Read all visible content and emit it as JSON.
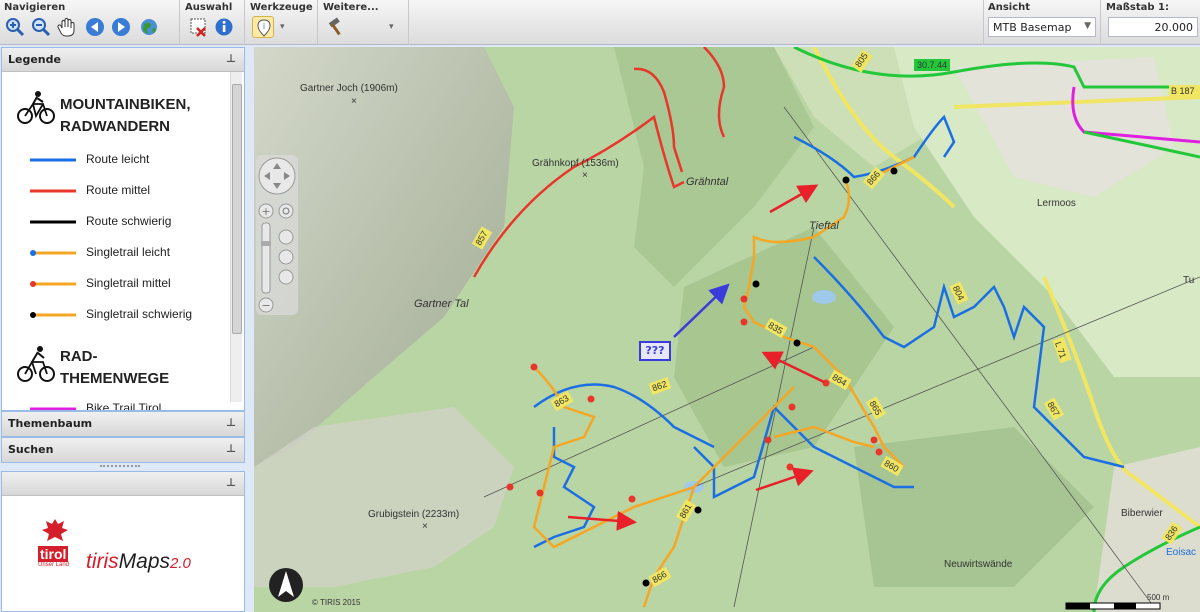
{
  "toolbar": {
    "navigate_label": "Navigieren",
    "select_label": "Auswahl",
    "tools_label": "Werkzeuge",
    "more_label": "Weitere...",
    "view_label": "Ansicht",
    "view_value": "MTB Basemap",
    "scale_label": "Maßstab 1:",
    "scale_value": "20.000",
    "icons": [
      "zoom-in-icon",
      "zoom-out-icon",
      "pan-hand-icon",
      "back-arrow-icon",
      "forward-arrow-icon",
      "globe-icon",
      "clear-selection-icon",
      "info-icon",
      "identify-icon",
      "hammer-icon"
    ]
  },
  "legend": {
    "header": "Legende",
    "section1_line1": "MOUNTAINBIKEN,",
    "section1_line2": "RADWANDERN",
    "items": [
      {
        "label": "Route leicht",
        "color": "#1c6fe3",
        "dot": ""
      },
      {
        "label": "Route mittel",
        "color": "#e8362b",
        "dot": ""
      },
      {
        "label": "Route schwierig",
        "color": "#000000",
        "dot": ""
      },
      {
        "label": "Singletrail leicht",
        "color": "#f5a623",
        "dot": "#1c6fe3"
      },
      {
        "label": "Singletrail mittel",
        "color": "#f5a623",
        "dot": "#e8362b"
      },
      {
        "label": "Singletrail schwierig",
        "color": "#f5a623",
        "dot": "#000000"
      }
    ],
    "section2_line1": "RAD-",
    "section2_line2": "THEMENWEGE",
    "cut_item": "Bike Trail Tirol"
  },
  "panels": {
    "themes": "Themenbaum",
    "search": "Suchen"
  },
  "logo": {
    "brand": "tiris",
    "product": "Maps",
    "version": "2.0",
    "sub": "tirol",
    "sub2": "Unser Land"
  },
  "map": {
    "labels": {
      "gartner_joch": "Gartner Joch (1906m)",
      "graehnkopf": "Grähnkopf (1536m)",
      "graehntal": "Grähntal",
      "tieftal": "Tieftal",
      "gartner_tal": "Gartner Tal",
      "grubigstein": "Grubigstein (2233m)",
      "neuwirtswaende": "Neuwirtswände",
      "lermoos": "Lermoos",
      "biberwier": "Biberwier",
      "eoisac": "Eoisac",
      "tu": "Tu",
      "question": "???",
      "copyright": "© TIRIS 2015",
      "scalebar": "500 m"
    },
    "route_numbers": [
      "805",
      "30.7.44",
      "B 187",
      "866",
      "857",
      "804",
      "835",
      "864",
      "865",
      "862",
      "863",
      "860",
      "861",
      "866",
      "L 71",
      "867",
      "836"
    ],
    "colors": {
      "route_easy": "#1c6fe3",
      "route_medium": "#e8362b",
      "route_hard": "#000000",
      "singletrail": "#f5a623",
      "road_yellow": "#f0e663",
      "bike_green": "#22c83a",
      "bike_magenta": "#e020e0",
      "annotation_arrow": "#e8202a",
      "annotation_blue": "#3b3bdb"
    }
  }
}
